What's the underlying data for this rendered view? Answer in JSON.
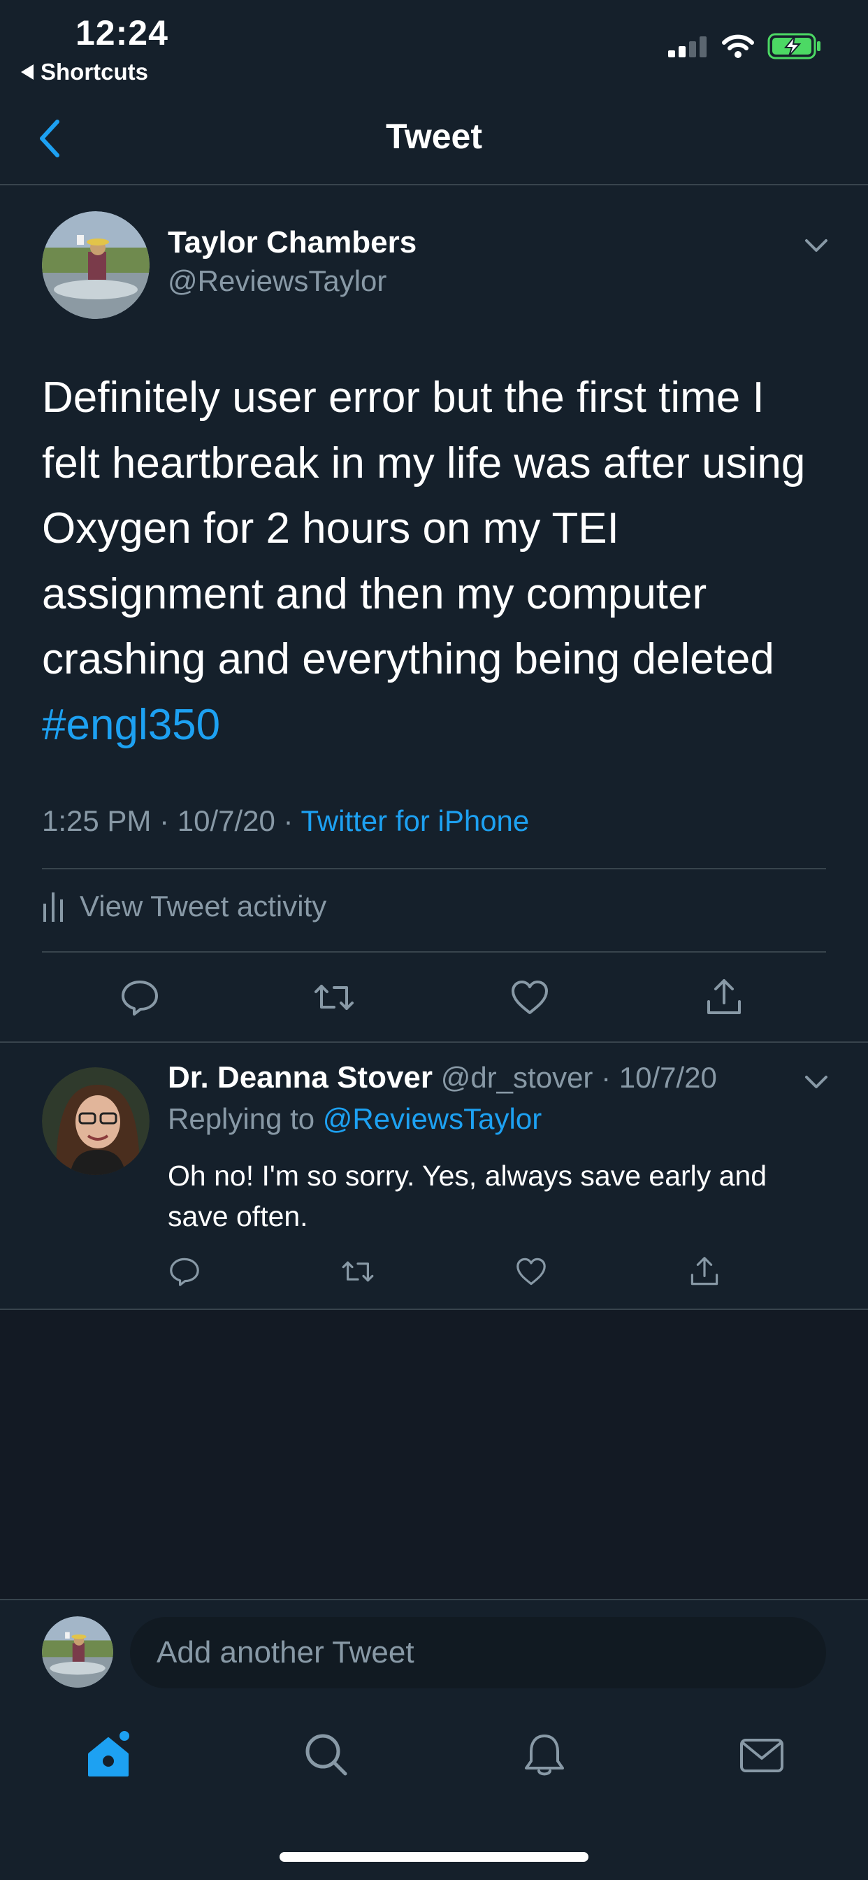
{
  "status_bar": {
    "time": "12:24",
    "back_app": "Shortcuts",
    "battery_color": "#4cd964"
  },
  "header": {
    "title": "Tweet"
  },
  "tweet": {
    "author_name": "Taylor Chambers",
    "author_handle": "@ReviewsTaylor",
    "text": "Definitely user error but the first time I felt heartbreak in my life was after using Oxygen for 2 hours on my TEI assignment and then my computer crashing and everything being deleted",
    "hashtag": "#engl350",
    "timestamp": "1:25 PM · 10/7/20 ·",
    "source": "Twitter for iPhone",
    "activity_label": "View Tweet activity",
    "actions": [
      "reply-icon",
      "retweet-icon",
      "like-icon",
      "share-icon"
    ]
  },
  "reply": {
    "author_name": "Dr. Deanna Stover",
    "author_handle": "@dr_stover",
    "date": "· 10/7/20",
    "replying_prefix": "Replying to",
    "replying_handle": "@ReviewsTaylor",
    "text": "Oh no! I'm so sorry. Yes, always save early and save often."
  },
  "composer": {
    "placeholder": "Add another Tweet"
  },
  "tab_bar": {
    "items": [
      "home-icon",
      "search-icon",
      "notifications-icon",
      "messages-icon"
    ],
    "active": "home-icon"
  },
  "colors": {
    "background": "#15202b",
    "accent": "#1da1f2",
    "muted": "#8899a6",
    "divider": "#38444d"
  }
}
